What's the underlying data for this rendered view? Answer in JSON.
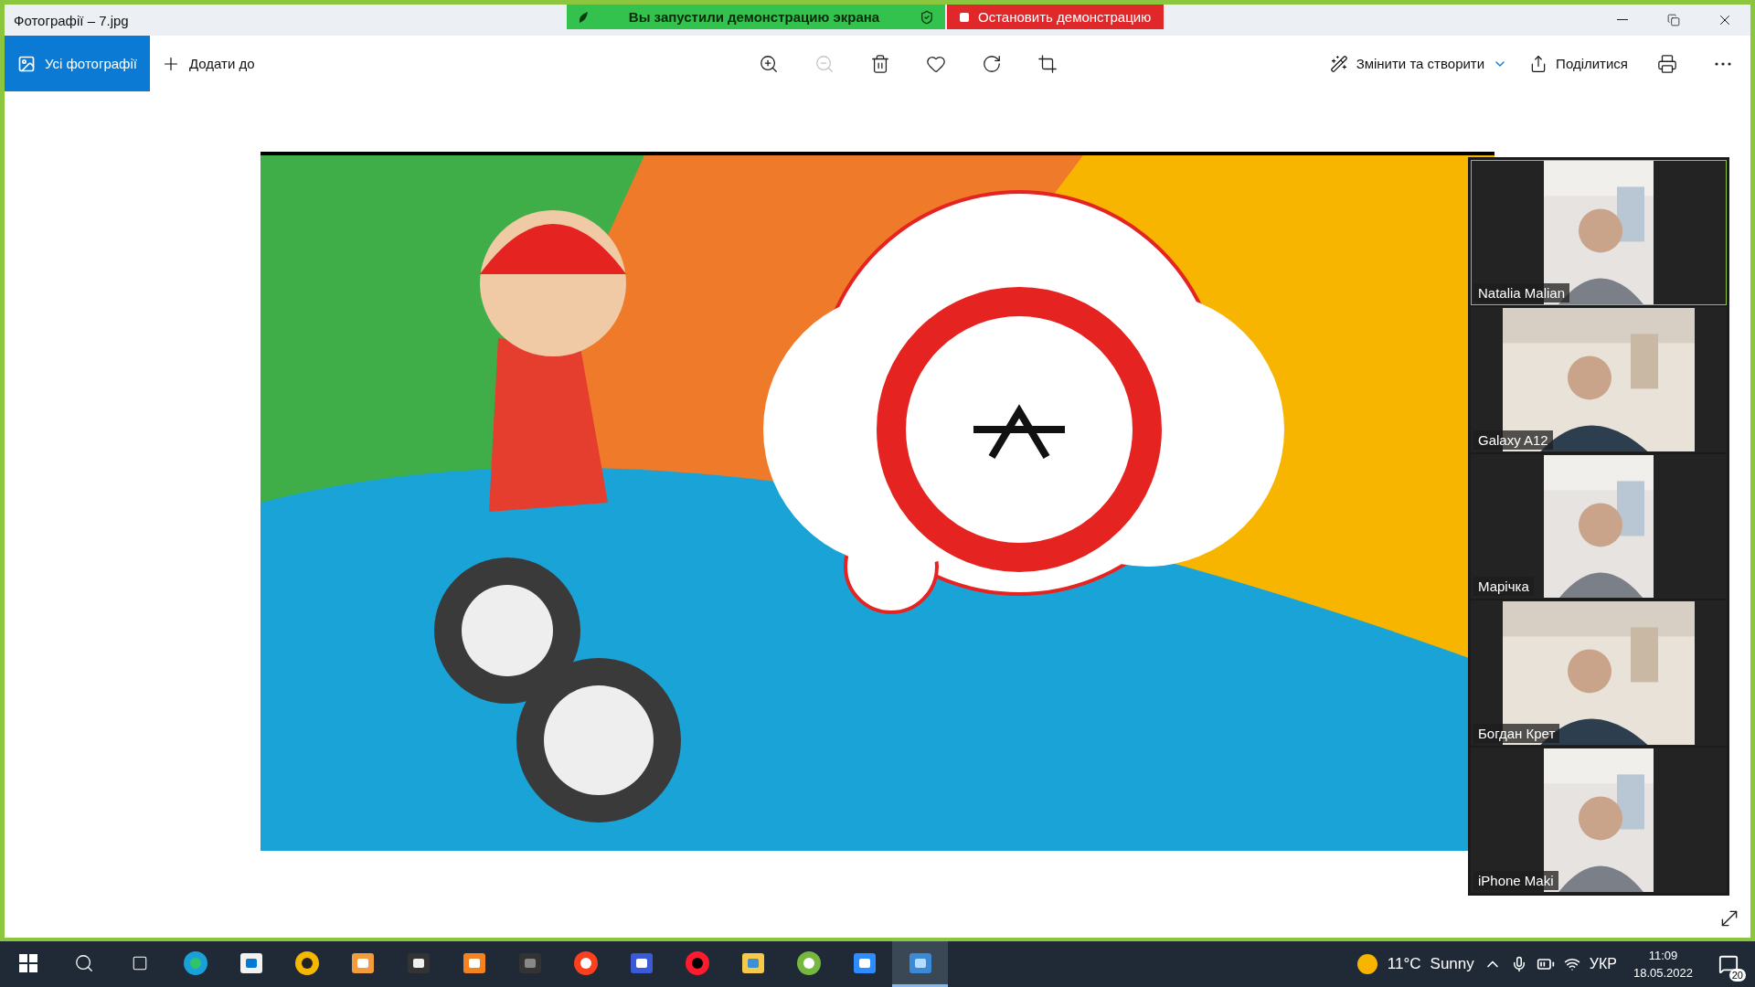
{
  "window": {
    "title": "Фотографії – 7.jpg"
  },
  "share_banner": {
    "status": "Вы запустили демонстрацию экрана",
    "stop": "Остановить демонстрацию"
  },
  "toolbar": {
    "all_photos": {
      "label": "Усі фотографії",
      "selected": true
    },
    "add_to": "Додати до",
    "tools": [
      {
        "kind": "zoom-in",
        "disabled": false
      },
      {
        "kind": "zoom-out",
        "disabled": true
      },
      {
        "kind": "delete",
        "disabled": false
      },
      {
        "kind": "favorite",
        "disabled": false
      },
      {
        "kind": "rotate",
        "disabled": false
      },
      {
        "kind": "crop",
        "disabled": false
      }
    ],
    "edit_create": "Змінити та створити",
    "share": "Поділитися"
  },
  "participants": [
    {
      "name": "Natalia Malian",
      "selected": true,
      "kind": "portrait"
    },
    {
      "name": "Galaxy A12",
      "selected": false,
      "kind": "landscape"
    },
    {
      "name": "Марічка",
      "selected": false,
      "kind": "portrait"
    },
    {
      "name": "Богдан Крет",
      "selected": false,
      "kind": "landscape"
    },
    {
      "name": "iPhone Maki",
      "selected": false,
      "kind": "portrait"
    }
  ],
  "taskbar": {
    "apps": [
      {
        "kind": "edge",
        "selected": false
      },
      {
        "kind": "store",
        "selected": false
      },
      {
        "kind": "aimp",
        "selected": false
      },
      {
        "kind": "player",
        "selected": false
      },
      {
        "kind": "clapper",
        "selected": false
      },
      {
        "kind": "pdf",
        "selected": false
      },
      {
        "kind": "camera",
        "selected": false
      },
      {
        "kind": "yandex",
        "selected": false
      },
      {
        "kind": "floppy",
        "selected": false
      },
      {
        "kind": "opera",
        "selected": false
      },
      {
        "kind": "folder",
        "selected": false
      },
      {
        "kind": "torrent",
        "selected": false
      },
      {
        "kind": "zoom",
        "selected": false
      },
      {
        "kind": "photos",
        "selected": true
      }
    ],
    "temperature": "11°C",
    "weather": "Sunny",
    "language": "УКР",
    "time": "11:09",
    "date": "18.05.2022",
    "notifications": "20"
  }
}
